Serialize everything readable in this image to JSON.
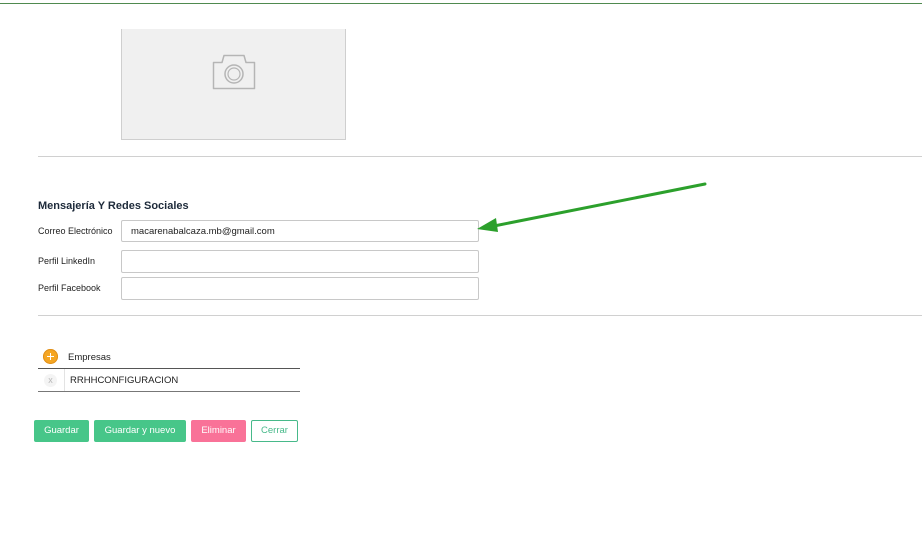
{
  "photo": {
    "icon": "camera-icon"
  },
  "social": {
    "title": "Mensajería Y Redes Sociales",
    "fields": [
      {
        "label": "Correo Electrónico",
        "value": "macarenabalcaza.mb@gmail.com"
      },
      {
        "label": "Perfil LinkedIn",
        "value": ""
      },
      {
        "label": "Perfil Facebook",
        "value": ""
      }
    ]
  },
  "companies": {
    "header": "Empresas",
    "add_icon": "plus-circle-icon",
    "remove_icon": "x-icon",
    "remove_glyph": "x",
    "rows": [
      {
        "name": "RRHHCONFIGURACION"
      }
    ]
  },
  "actions": {
    "save": "Guardar",
    "save_new": "Guardar y nuevo",
    "delete": "Eliminar",
    "close": "Cerrar"
  },
  "colors": {
    "green": "#47c689",
    "pink": "#f97298",
    "annotation_arrow": "#2ca02c",
    "add_icon": "#f5a623"
  }
}
